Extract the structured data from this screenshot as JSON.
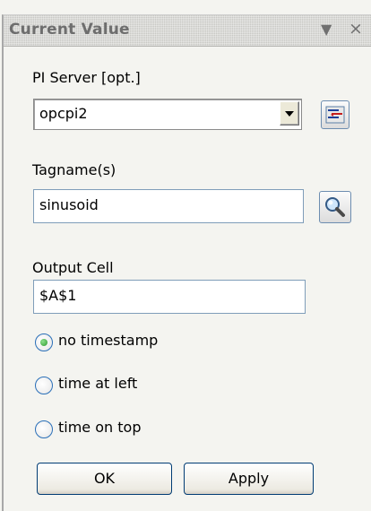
{
  "panel": {
    "title": "Current Value",
    "dropdown_glyph": "▼",
    "close_glyph": "×"
  },
  "server": {
    "label": "PI Server [opt.]",
    "value": "opcpi2",
    "connections_icon": "server-connections-icon"
  },
  "tags": {
    "label": "Tagname(s)",
    "value": "sinusoid",
    "search_icon": "magnifier-icon"
  },
  "output": {
    "label": "Output Cell",
    "value": "$A$1"
  },
  "timestamp_options": [
    {
      "label": "no timestamp",
      "checked": true
    },
    {
      "label": "time at left",
      "checked": false
    },
    {
      "label": "time on top",
      "checked": false
    }
  ],
  "buttons": {
    "ok": "OK",
    "apply": "Apply"
  },
  "colors": {
    "accent_border": "#7f9db9",
    "radio_selected": "#2f9a2f"
  }
}
